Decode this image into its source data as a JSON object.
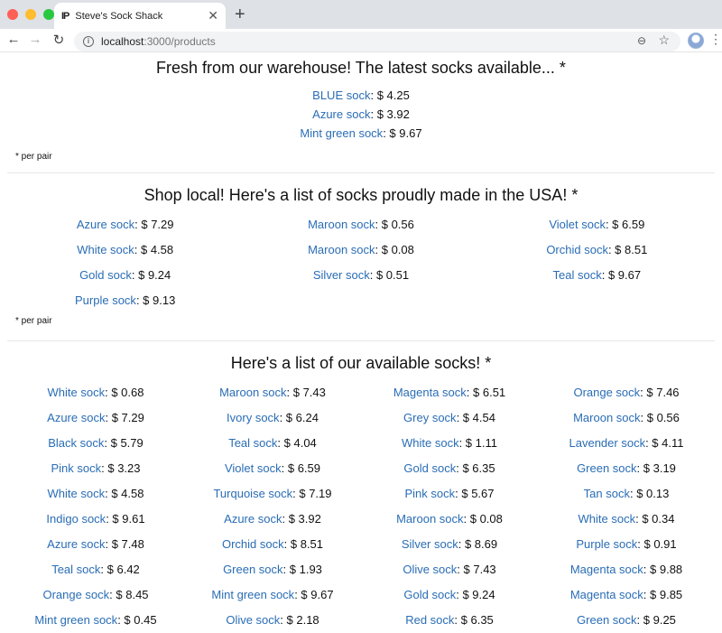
{
  "browser": {
    "tab_title": "Steve's Sock Shack",
    "favicon_text": "IP",
    "url_host": "localhost",
    "url_rest": ":3000/products",
    "traffic_colors": [
      "#fe5f57",
      "#febc2e",
      "#28c840"
    ]
  },
  "latest": {
    "title": "Fresh from our warehouse! The latest socks available... *",
    "items": [
      {
        "name": "BLUE sock",
        "price": ": $ 4.25"
      },
      {
        "name": "Azure sock",
        "price": ": $ 3.92"
      },
      {
        "name": "Mint green sock",
        "price": ": $ 9.67"
      }
    ],
    "footnote": "* per pair"
  },
  "usa": {
    "title": "Shop local! Here's a list of socks proudly made in the USA! *",
    "items": [
      {
        "name": "Azure sock",
        "price": ": $ 7.29"
      },
      {
        "name": "Maroon sock",
        "price": ": $ 0.56"
      },
      {
        "name": "Violet sock",
        "price": ": $ 6.59"
      },
      {
        "name": "White sock",
        "price": ": $ 4.58"
      },
      {
        "name": "Maroon sock",
        "price": ": $ 0.08"
      },
      {
        "name": "Orchid sock",
        "price": ": $ 8.51"
      },
      {
        "name": "Gold sock",
        "price": ": $ 9.24"
      },
      {
        "name": "Silver sock",
        "price": ": $ 0.51"
      },
      {
        "name": "Teal sock",
        "price": ": $ 9.67"
      },
      {
        "name": "Purple sock",
        "price": ": $ 9.13"
      }
    ],
    "footnote": "* per pair"
  },
  "all": {
    "title": "Here's a list of our available socks! *",
    "items": [
      {
        "name": "White sock",
        "price": ": $ 0.68"
      },
      {
        "name": "Maroon sock",
        "price": ": $ 7.43"
      },
      {
        "name": "Magenta sock",
        "price": ": $ 6.51"
      },
      {
        "name": "Orange sock",
        "price": ": $ 7.46"
      },
      {
        "name": "Azure sock",
        "price": ": $ 7.29"
      },
      {
        "name": "Ivory sock",
        "price": ": $ 6.24"
      },
      {
        "name": "Grey sock",
        "price": ": $ 4.54"
      },
      {
        "name": "Maroon sock",
        "price": ": $ 0.56"
      },
      {
        "name": "Black sock",
        "price": ": $ 5.79"
      },
      {
        "name": "Teal sock",
        "price": ": $ 4.04"
      },
      {
        "name": "White sock",
        "price": ": $ 1.11"
      },
      {
        "name": "Lavender sock",
        "price": ": $ 4.11"
      },
      {
        "name": "Pink sock",
        "price": ": $ 3.23"
      },
      {
        "name": "Violet sock",
        "price": ": $ 6.59"
      },
      {
        "name": "Gold sock",
        "price": ": $ 6.35"
      },
      {
        "name": "Green sock",
        "price": ": $ 3.19"
      },
      {
        "name": "White sock",
        "price": ": $ 4.58"
      },
      {
        "name": "Turquoise sock",
        "price": ": $ 7.19"
      },
      {
        "name": "Pink sock",
        "price": ": $ 5.67"
      },
      {
        "name": "Tan sock",
        "price": ": $ 0.13"
      },
      {
        "name": "Indigo sock",
        "price": ": $ 9.61"
      },
      {
        "name": "Azure sock",
        "price": ": $ 3.92"
      },
      {
        "name": "Maroon sock",
        "price": ": $ 0.08"
      },
      {
        "name": "White sock",
        "price": ": $ 0.34"
      },
      {
        "name": "Azure sock",
        "price": ": $ 7.48"
      },
      {
        "name": "Orchid sock",
        "price": ": $ 8.51"
      },
      {
        "name": "Silver sock",
        "price": ": $ 8.69"
      },
      {
        "name": "Purple sock",
        "price": ": $ 0.91"
      },
      {
        "name": "Teal sock",
        "price": ": $ 6.42"
      },
      {
        "name": "Green sock",
        "price": ": $ 1.93"
      },
      {
        "name": "Olive sock",
        "price": ": $ 7.43"
      },
      {
        "name": "Magenta sock",
        "price": ": $ 9.88"
      },
      {
        "name": "Orange sock",
        "price": ": $ 8.45"
      },
      {
        "name": "Mint green sock",
        "price": ": $ 9.67"
      },
      {
        "name": "Gold sock",
        "price": ": $ 9.24"
      },
      {
        "name": "Magenta sock",
        "price": ": $ 9.85"
      },
      {
        "name": "Mint green sock",
        "price": ": $ 0.45"
      },
      {
        "name": "Olive sock",
        "price": ": $ 2.18"
      },
      {
        "name": "Red sock",
        "price": ": $ 6.35"
      },
      {
        "name": "Green sock",
        "price": ": $ 9.25"
      }
    ]
  },
  "colors": {
    "link": "#2a6db5"
  }
}
